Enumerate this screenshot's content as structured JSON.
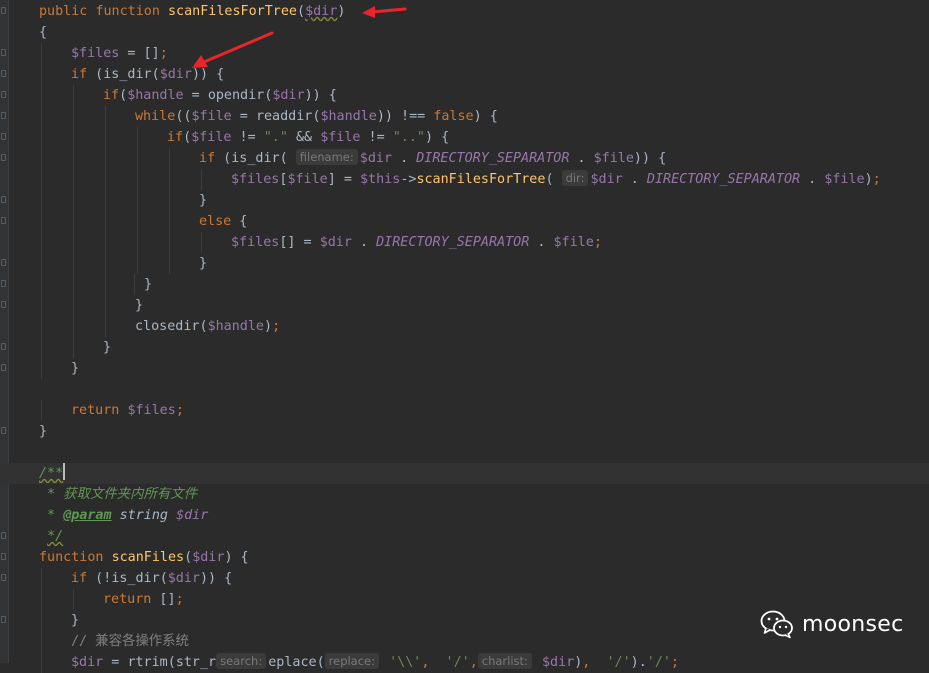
{
  "editor": {
    "colors": {
      "background": "#2b2b2b",
      "keyword": "#cc7832",
      "function": "#ffc66d",
      "variable": "#9876aa",
      "string": "#6a8759",
      "doc_comment": "#629755",
      "annotation_arrow": "#e8252a"
    },
    "hints": {
      "filename": "filename:",
      "dir": "dir:",
      "search": "search:",
      "replace": "replace:",
      "charlist": "charlist:"
    },
    "lines": [
      "public function scanFilesForTree($dir)",
      "{",
      "$files = [];",
      "if (is_dir($dir)) {",
      "if($handle = opendir($dir)) {",
      "while(($file = readdir($handle)) !== false) {",
      "if($file != \".\" && $file != \"..\") {",
      "if (is_dir( $dir . DIRECTORY_SEPARATOR . $file)) {",
      "$files[$file] = $this->scanFilesForTree( $dir . DIRECTORY_SEPARATOR . $file);",
      "}",
      "else {",
      "$files[] = $dir . DIRECTORY_SEPARATOR . $file;",
      "}",
      "}",
      "}",
      "closedir($handle);",
      "}",
      "}",
      "",
      "return $files;",
      "}",
      "",
      "/**",
      "* 获取文件夹内所有文件",
      "* @param string $dir",
      "*/",
      "function scanFiles($dir) {",
      "if (!is_dir($dir)) {",
      "return [];",
      "}",
      "// 兼容各操作系统",
      "$dir = rtrim(str_replace( '\\\\',  '/', $dir),  '/').'/';"
    ]
  },
  "watermark": {
    "logo": "wechat-logo",
    "text": "moonsec"
  }
}
